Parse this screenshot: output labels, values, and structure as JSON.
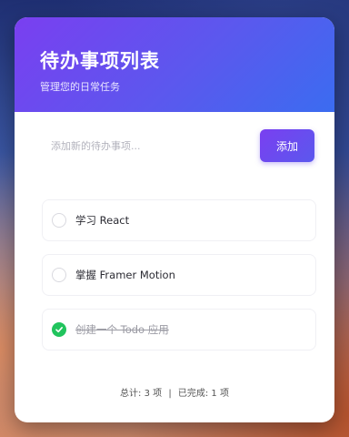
{
  "header": {
    "title": "待办事项列表",
    "subtitle": "管理您的日常任务"
  },
  "add_form": {
    "placeholder": "添加新的待办事项...",
    "button_label": "添加"
  },
  "todos": [
    {
      "label": "学习 React",
      "completed": false
    },
    {
      "label": "掌握 Framer Motion",
      "completed": false
    },
    {
      "label": "创建一个 Todo 应用",
      "completed": true
    }
  ],
  "footer": {
    "total_text": "总计: 3 项",
    "separator": "|",
    "completed_text": "已完成: 1 项"
  },
  "colors": {
    "accent": "#6a4df0",
    "done": "#21c45d"
  }
}
